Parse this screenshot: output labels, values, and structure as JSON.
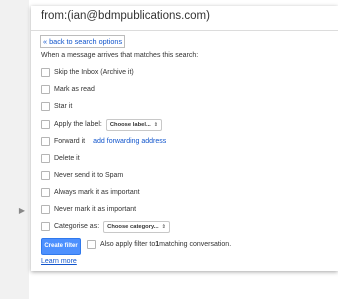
{
  "search": {
    "query": "from:(ian@bdmpublications.com)"
  },
  "filter": {
    "back_link": "« back to search options",
    "intro": "When a message arrives that matches this search:",
    "options": {
      "skip_inbox": "Skip the Inbox (Archive it)",
      "mark_read": "Mark as read",
      "star": "Star it",
      "apply_label": "Apply the label:",
      "label_select": "Choose label...",
      "forward": "Forward it",
      "add_forwarding": "add forwarding address",
      "delete": "Delete it",
      "never_spam": "Never send it to Spam",
      "always_important": "Always mark it as important",
      "never_important": "Never mark it as important",
      "categorise": "Categorise as:",
      "category_select": "Choose category..."
    },
    "create_button": "Create filter",
    "also_apply_prefix": "Also apply filter to ",
    "also_apply_count": "1",
    "also_apply_suffix": " matching conversation.",
    "learn_more": "Learn more"
  },
  "colors": {
    "accent": "#4d90fe",
    "link": "#1155cc"
  }
}
